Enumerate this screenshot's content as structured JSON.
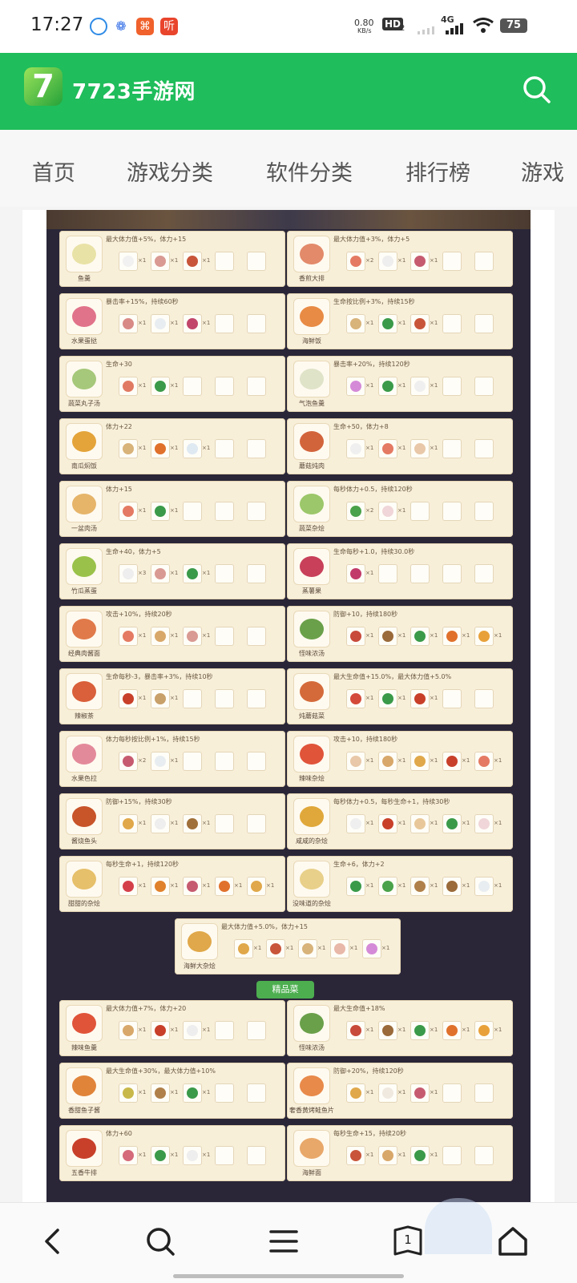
{
  "status_bar": {
    "time": "17:27",
    "net_speed": "0.80",
    "net_unit": "KB/s",
    "hd": "HD",
    "sim2": "2",
    "net_type": "4G",
    "battery": "75",
    "app_icons": [
      "qq-browser-icon",
      "baidu-icon",
      "app-icon",
      "ting-icon"
    ],
    "app4_text": "听"
  },
  "header": {
    "logo_mark": "7",
    "site_name": "7723手游网",
    "brand_color": "#1fbd5b"
  },
  "tabs": [
    "首页",
    "游戏分类",
    "软件分类",
    "排行榜",
    "游戏"
  ],
  "recipes": [
    {
      "name": "鱼羹",
      "effect": "最大体力值+5%，体力+15",
      "color": "#e9e2a6",
      "ingredients": [
        [
          "#f1f1f1",
          "×1"
        ],
        [
          "#d99a93",
          "×1"
        ],
        [
          "#c8553a",
          "×1"
        ]
      ]
    },
    {
      "name": "香煎大排",
      "effect": "最大体力值+3%，体力+5",
      "color": "#e28a6a",
      "ingredients": [
        [
          "#e47a63",
          "×2"
        ],
        [
          "#eeeeee",
          "×1"
        ],
        [
          "#c65b70",
          "×1"
        ]
      ]
    },
    {
      "name": "水果蛋挞",
      "effect": "暴击率+15%，持续60秒",
      "color": "#e0738a",
      "ingredients": [
        [
          "#d88a86",
          "×1"
        ],
        [
          "#e8edf1",
          "×1"
        ],
        [
          "#c2466b",
          "×1"
        ]
      ]
    },
    {
      "name": "海鲜饭",
      "effect": "生命按比例+3%，持续15秒",
      "color": "#e88b45",
      "ingredients": [
        [
          "#d8b37a",
          "×1"
        ],
        [
          "#3a9a4a",
          "×1"
        ],
        [
          "#c8553a",
          "×1"
        ]
      ]
    },
    {
      "name": "蔬菜丸子汤",
      "effect": "生命+30",
      "color": "#a6c87a",
      "ingredients": [
        [
          "#e07a63",
          "×1"
        ],
        [
          "#3a9a4a",
          "×1"
        ]
      ]
    },
    {
      "name": "气泡鱼羹",
      "effect": "暴击率+20%，持续120秒",
      "color": "#dfe3c8",
      "ingredients": [
        [
          "#d58ad8",
          "×1"
        ],
        [
          "#3a9a4a",
          "×1"
        ],
        [
          "#efefef",
          "×1"
        ]
      ]
    },
    {
      "name": "南瓜焖饭",
      "effect": "体力+22",
      "color": "#e4a43a",
      "ingredients": [
        [
          "#d8b37a",
          "×1"
        ],
        [
          "#e0712c",
          "×1"
        ],
        [
          "#dfe9f2",
          "×1"
        ]
      ]
    },
    {
      "name": "蘑菇炖肉",
      "effect": "生命+50，体力+8",
      "color": "#d2643c",
      "ingredients": [
        [
          "#efefef",
          "×1"
        ],
        [
          "#e47a63",
          "×1"
        ],
        [
          "#e8c8a8",
          "×1"
        ]
      ]
    },
    {
      "name": "一盆肉汤",
      "effect": "体力+15",
      "color": "#e6b56a",
      "ingredients": [
        [
          "#e47a63",
          "×1"
        ],
        [
          "#3a9a4a",
          "×1"
        ]
      ]
    },
    {
      "name": "蔬菜杂烩",
      "effect": "每秒体力+0.5，持续120秒",
      "color": "#9cc76a",
      "ingredients": [
        [
          "#4aa24a",
          "×2"
        ],
        [
          "#f0d6d8",
          "×1"
        ]
      ]
    },
    {
      "name": "竹瓜蒸蛋",
      "effect": "生命+40，体力+5",
      "color": "#9ac24a",
      "ingredients": [
        [
          "#eeeeee",
          "×3"
        ],
        [
          "#d99a93",
          "×1"
        ],
        [
          "#3a9a4a",
          "×1"
        ]
      ]
    },
    {
      "name": "蒸薯果",
      "effect": "生命每秒+1.0，持续30.0秒",
      "color": "#c8405a",
      "ingredients": [
        [
          "#c23a6a",
          "×1"
        ]
      ]
    },
    {
      "name": "经典肉酱面",
      "effect": "攻击+10%，持续20秒",
      "color": "#e07a4a",
      "ingredients": [
        [
          "#e47a63",
          "×1"
        ],
        [
          "#d8a86a",
          "×1"
        ],
        [
          "#d99a93",
          "×1"
        ]
      ]
    },
    {
      "name": "怪味浓汤",
      "effect": "防御+10，持续180秒",
      "color": "#6aa04a",
      "ingredients": [
        [
          "#c84a3a",
          "×1"
        ],
        [
          "#9a6a3a",
          "×1"
        ],
        [
          "#3a9a4a",
          "×1"
        ],
        [
          "#e0712c",
          "×1"
        ],
        [
          "#e8a13a",
          "×1"
        ]
      ]
    },
    {
      "name": "辣椒茶",
      "effect": "生命每秒-3，暴击率+3%，持续10秒",
      "color": "#d9603a",
      "ingredients": [
        [
          "#c8402a",
          "×1"
        ],
        [
          "#c8a06a",
          "×1"
        ]
      ]
    },
    {
      "name": "炖蘑菇菜",
      "effect": "最大生命值+15.0%，最大体力值+5.0%",
      "color": "#d46a3a",
      "ingredients": [
        [
          "#d44a3a",
          "×1"
        ],
        [
          "#3a9a4a",
          "×1"
        ],
        [
          "#c8402a",
          "×1"
        ]
      ]
    },
    {
      "name": "水果色拉",
      "effect": "体力每秒按比例+1%，持续15秒",
      "color": "#e38a9a",
      "ingredients": [
        [
          "#c65b70",
          "×2"
        ],
        [
          "#e8edf1",
          "×1"
        ]
      ]
    },
    {
      "name": "辣味杂烩",
      "effect": "攻击+10，持续180秒",
      "color": "#e0543a",
      "ingredients": [
        [
          "#e8c8a8",
          "×1"
        ],
        [
          "#d8a86a",
          "×1"
        ],
        [
          "#e0a84a",
          "×1"
        ],
        [
          "#c8402a",
          "×1"
        ],
        [
          "#e47a63",
          "×1"
        ]
      ]
    },
    {
      "name": "酱烧鱼头",
      "effect": "防御+15%，持续30秒",
      "color": "#c8542a",
      "ingredients": [
        [
          "#e0a84a",
          "×1"
        ],
        [
          "#eeeeee",
          "×1"
        ],
        [
          "#a0703a",
          "×1"
        ]
      ]
    },
    {
      "name": "咸咸的杂烩",
      "effect": "每秒体力+0.5，每秒生命+1，持续30秒",
      "color": "#e0a83a",
      "ingredients": [
        [
          "#efefef",
          "×1"
        ],
        [
          "#c8402a",
          "×1"
        ],
        [
          "#e8c89a",
          "×1"
        ],
        [
          "#3a9a4a",
          "×1"
        ],
        [
          "#f0d6d8",
          "×1"
        ]
      ]
    },
    {
      "name": "甜甜的杂烩",
      "effect": "每秒生命+1，持续120秒",
      "color": "#e6c06a",
      "ingredients": [
        [
          "#d4404a",
          "×1"
        ],
        [
          "#e0812c",
          "×1"
        ],
        [
          "#c65b70",
          "×1"
        ],
        [
          "#e0712c",
          "×1"
        ],
        [
          "#e0a84a",
          "×1"
        ]
      ]
    },
    {
      "name": "没味道的杂烩",
      "effect": "生命+6，体力+2",
      "color": "#e8d08a",
      "ingredients": [
        [
          "#3a9a4a",
          "×1"
        ],
        [
          "#4aa24a",
          "×1"
        ],
        [
          "#b0804a",
          "×1"
        ],
        [
          "#9a6a3a",
          "×1"
        ],
        [
          "#e8edf1",
          "×1"
        ]
      ]
    }
  ],
  "special_recipe": {
    "name": "海鲜大杂烩",
    "effect": "最大体力值+5.0%，体力+15",
    "color": "#e0a84a",
    "ingredients": [
      [
        "#e0a84a",
        "×1"
      ],
      [
        "#c8553a",
        "×1"
      ],
      [
        "#d8b37a",
        "×1"
      ],
      [
        "#e8b8a8",
        "×1"
      ],
      [
        "#d58ad8",
        "×1"
      ]
    ]
  },
  "section_title": "精品菜",
  "premium_recipes": [
    {
      "name": "辣味鱼羹",
      "effect": "最大体力值+7%，体力+20",
      "color": "#e0543a",
      "ingredients": [
        [
          "#d8a86a",
          "×1"
        ],
        [
          "#c8402a",
          "×1"
        ],
        [
          "#eeeeee",
          "×1"
        ]
      ]
    },
    {
      "name": "怪味浓汤",
      "effect": "最大生命值+18%",
      "color": "#6aa04a",
      "ingredients": [
        [
          "#c84a3a",
          "×1"
        ],
        [
          "#9a6a3a",
          "×1"
        ],
        [
          "#3a9a4a",
          "×1"
        ],
        [
          "#e0712c",
          "×1"
        ],
        [
          "#e8a13a",
          "×1"
        ]
      ]
    },
    {
      "name": "香甜鱼子酱",
      "effect": "最大生命值+30%，最大体力值+10%",
      "color": "#e0843a",
      "ingredients": [
        [
          "#c8b84a",
          "×1"
        ],
        [
          "#b0804a",
          "×1"
        ],
        [
          "#3a9a4a",
          "×1"
        ]
      ]
    },
    {
      "name": "奢香黄烤鲑鱼片",
      "effect": "防御+20%，持续120秒",
      "color": "#e88a4a",
      "ingredients": [
        [
          "#e0a84a",
          "×1"
        ],
        [
          "#efe9e0",
          "×1"
        ],
        [
          "#c65b70",
          "×1"
        ]
      ]
    },
    {
      "name": "五香牛排",
      "effect": "体力+60",
      "color": "#c8402a",
      "ingredients": [
        [
          "#d46a7a",
          "×1"
        ],
        [
          "#3a9a4a",
          "×1"
        ],
        [
          "#eeeeee",
          "×1"
        ]
      ]
    },
    {
      "name": "海鲜面",
      "effect": "每秒生命+15，持续20秒",
      "color": "#e8a86a",
      "ingredients": [
        [
          "#c8553a",
          "×1"
        ],
        [
          "#d8a86a",
          "×1"
        ],
        [
          "#3a9a4a",
          "×1"
        ]
      ]
    }
  ],
  "bottom_nav": [
    {
      "name": "back-icon"
    },
    {
      "name": "search-icon"
    },
    {
      "name": "menu-icon"
    },
    {
      "name": "tabs-icon",
      "count": "1"
    },
    {
      "name": "home-icon"
    }
  ]
}
